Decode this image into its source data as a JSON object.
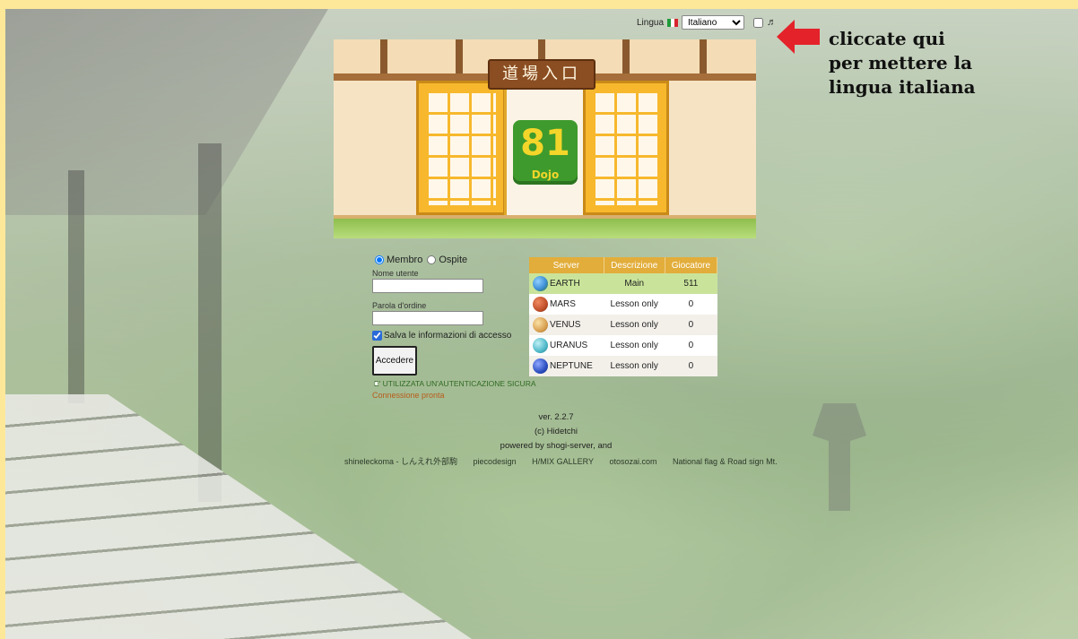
{
  "language": {
    "label": "Lingua",
    "selected": "Italiano",
    "options": [
      "Italiano"
    ],
    "flag_colors": [
      "#1f9a3a",
      "#ffffff",
      "#d8262e"
    ]
  },
  "annotation": {
    "line1": "cliccate qui",
    "line2": "per mettere la",
    "line3": "lingua italiana",
    "arrow_color": "#e4222a"
  },
  "banner": {
    "sign_text": "道場入口",
    "logo_number": "81",
    "logo_sub": "Dojo"
  },
  "login": {
    "radio_member": "Membro",
    "radio_guest": "Ospite",
    "username_label": "Nome utente",
    "username_value": "",
    "password_label": "Parola d'ordine",
    "password_value": "",
    "save_label": "Salva le informazioni di accesso",
    "save_checked": true,
    "login_button": "Accedere",
    "secure_text": "E' UTILIZZATA UN'AUTENTICAZIONE SICURA",
    "status_text": "Connessione pronta"
  },
  "servers": {
    "headers": [
      "Server",
      "Descrizione",
      "Giocatore"
    ],
    "rows": [
      {
        "name": "EARTH",
        "desc": "Main",
        "players": "511",
        "color": "#3f8fd6"
      },
      {
        "name": "MARS",
        "desc": "Lesson only",
        "players": "0",
        "color": "#c0502a"
      },
      {
        "name": "VENUS",
        "desc": "Lesson only",
        "players": "0",
        "color": "#d8a050"
      },
      {
        "name": "URANUS",
        "desc": "Lesson only",
        "players": "0",
        "color": "#4fb8c8"
      },
      {
        "name": "NEPTUNE",
        "desc": "Lesson only",
        "players": "0",
        "color": "#2c4fc0"
      }
    ]
  },
  "footer": {
    "version": "ver. 2.2.7",
    "copyright": "(c) Hidetchi",
    "powered": "powered by shogi-server, and",
    "credits": [
      "shineleckoma - しんえれ外部駒",
      "piecodesign",
      "H/MIX GALLERY",
      "otosozai.com",
      "National flag & Road sign Mt."
    ]
  }
}
